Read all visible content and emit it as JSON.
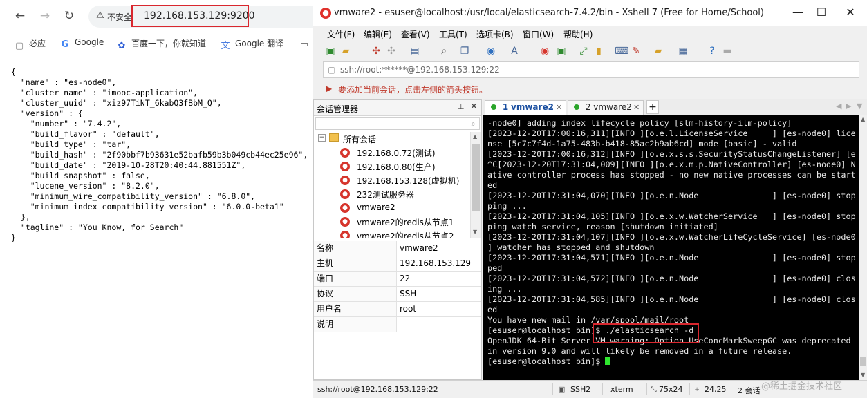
{
  "browser": {
    "security_label": "不安全",
    "url": "192.168.153.129:9200",
    "bookmarks": [
      "必应",
      "Google",
      "百度一下，你就知道",
      "Google 翻译"
    ],
    "json_response": "{\n  \"name\" : \"es-node0\",\n  \"cluster_name\" : \"imooc-application\",\n  \"cluster_uuid\" : \"xiz97TiNT_6kabQ3fBbM_Q\",\n  \"version\" : {\n    \"number\" : \"7.4.2\",\n    \"build_flavor\" : \"default\",\n    \"build_type\" : \"tar\",\n    \"build_hash\" : \"2f90bbf7b93631e52bafb59b3b049cb44ec25e96\",\n    \"build_date\" : \"2019-10-28T20:40:44.881551Z\",\n    \"build_snapshot\" : false,\n    \"lucene_version\" : \"8.2.0\",\n    \"minimum_wire_compatibility_version\" : \"6.8.0\",\n    \"minimum_index_compatibility_version\" : \"6.0.0-beta1\"\n  },\n  \"tagline\" : \"You Know, for Search\"\n}"
  },
  "xshell": {
    "window_title": "vmware2 - esuser@localhost:/usr/local/elasticsearch-7.4.2/bin - Xshell 7 (Free for Home/School)",
    "menu": [
      "文件(F)",
      "编辑(E)",
      "查看(V)",
      "工具(T)",
      "选项卡(B)",
      "窗口(W)",
      "帮助(H)"
    ],
    "address": "ssh://root:******@192.168.153.129:22",
    "hint": "要添加当前会话，点击左侧的箭头按钮。",
    "session_manager": {
      "title": "会话管理器",
      "root_folder": "所有会话",
      "sessions": [
        "192.168.0.72(测试)",
        "192.168.0.80(生产)",
        "192.168.153.128(虚拟机)",
        "232测试服务器",
        "vmware2",
        "vmware2的redis从节点1",
        "vmware2的redis从节点2"
      ]
    },
    "properties": [
      {
        "key": "名称",
        "value": "vmware2"
      },
      {
        "key": "主机",
        "value": "192.168.153.129"
      },
      {
        "key": "端口",
        "value": "22"
      },
      {
        "key": "协议",
        "value": "SSH"
      },
      {
        "key": "用户名",
        "value": "root"
      },
      {
        "key": "说明",
        "value": ""
      }
    ],
    "tabs": [
      {
        "num": "1",
        "label": "vmware2"
      },
      {
        "num": "2",
        "label": "vmware2"
      }
    ],
    "terminal_lines": [
      "-node0] adding index lifecycle policy [slm-history-ilm-policy]",
      "[2023-12-20T17:00:16,311][INFO ][o.e.l.LicenseService     ] [es-node0] lice",
      "nse [5c7c7f4d-1a75-483b-b418-85ac2b9ab6cd] mode [basic] - valid",
      "[2023-12-20T17:00:16,312][INFO ][o.e.x.s.s.SecurityStatusChangeListener] [e",
      "^C[2023-12-20T17:31:04,009][INFO ][o.e.x.m.p.NativeController] [es-node0] N",
      "ative controller process has stopped - no new native processes can be start",
      "ed",
      "[2023-12-20T17:31:04,070][INFO ][o.e.n.Node               ] [es-node0] stop",
      "ping ...",
      "[2023-12-20T17:31:04,105][INFO ][o.e.x.w.WatcherService   ] [es-node0] stop",
      "ping watch service, reason [shutdown initiated]",
      "[2023-12-20T17:31:04,107][INFO ][o.e.x.w.WatcherLifeCycleService] [es-node0",
      "] watcher has stopped and shutdown",
      "[2023-12-20T17:31:04,571][INFO ][o.e.n.Node               ] [es-node0] stop",
      "ped",
      "[2023-12-20T17:31:04,572][INFO ][o.e.n.Node               ] [es-node0] clos",
      "ing ...",
      "[2023-12-20T17:31:04,585][INFO ][o.e.n.Node               ] [es-node0] clos",
      "ed",
      "You have new mail in /var/spool/mail/root",
      "[esuser@localhost bin]$ ./elasticsearch -d",
      "OpenJDK 64-Bit Server VM warning: Option UseConcMarkSweepGC was deprecated",
      "in version 9.0 and will likely be removed in a future release.",
      "[esuser@localhost bin]$ "
    ],
    "status": {
      "connection": "ssh://root@192.168.153.129:22",
      "protocol": "SSH2",
      "terminal": "xterm",
      "size": "75x24",
      "cursor": "24,25",
      "sessions": "2 会话"
    },
    "watermark": "@稀土掘金技术社区"
  },
  "colors": {
    "highlight_red": "#d9272e",
    "terminal_bg": "#000000",
    "cursor_green": "#2ee62e",
    "hint_red": "#c0392b"
  }
}
